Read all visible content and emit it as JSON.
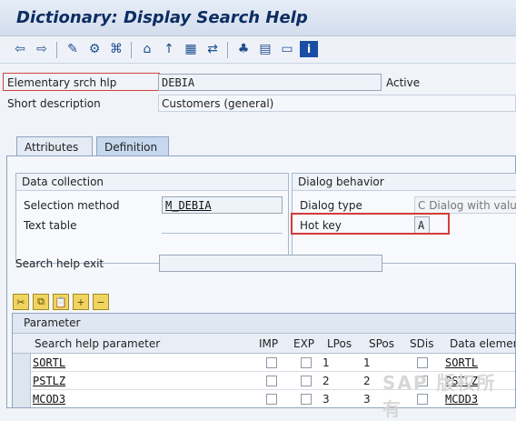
{
  "window": {
    "title": "Dictionary: Display Search Help"
  },
  "toolbar": {
    "items": [
      "back-arrow",
      "forward-arrow",
      "display-change",
      "activate",
      "object-list",
      "where-used",
      "graphic",
      "hierarchy",
      "other-object",
      "info"
    ]
  },
  "header": {
    "elementary_label": "Elementary srch hlp",
    "elementary_value": "DEBIA",
    "status": "Active",
    "short_desc_label": "Short description",
    "short_desc_value": "Customers (general)"
  },
  "tabs": [
    "Attributes",
    "Definition"
  ],
  "data_collection": {
    "title": "Data collection",
    "selection_method_label": "Selection method",
    "selection_method_value": "M_DEBIA",
    "text_table_label": "Text table"
  },
  "dialog_behavior": {
    "title": "Dialog behavior",
    "dialog_type_label": "Dialog type",
    "dialog_type_value": "C Dialog with value r",
    "hot_key_label": "Hot key",
    "hot_key_value": "A"
  },
  "search_exit": {
    "label": "Search help exit",
    "value": ""
  },
  "parameter_table": {
    "title": "Parameter",
    "columns": [
      "Search help parameter",
      "IMP",
      "EXP",
      "LPos",
      "SPos",
      "SDis",
      "Data element"
    ],
    "rows": [
      {
        "param": "SORTL",
        "lpos": "1",
        "spos": "1",
        "data_element": "SORTL"
      },
      {
        "param": "PSTLZ",
        "lpos": "2",
        "spos": "2",
        "data_element": "PSTLZ"
      },
      {
        "param": "MCOD3",
        "lpos": "3",
        "spos": "3",
        "data_element": "MCDD3"
      }
    ]
  },
  "colors": {
    "title": "#0b2d62",
    "accent": "#c5d8ee",
    "highlight": "#d53b3b"
  },
  "watermark": "SAP 版权所有"
}
